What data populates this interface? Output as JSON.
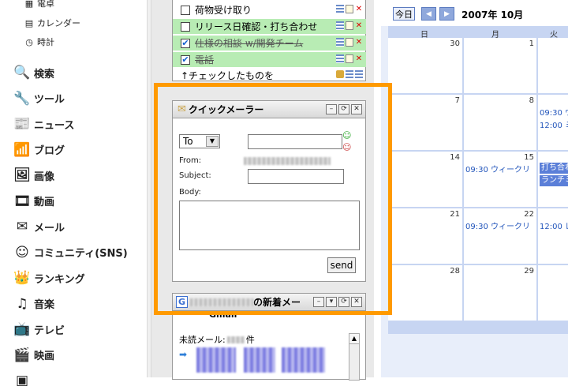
{
  "sidebar": {
    "sub_items": [
      {
        "label": "電卓",
        "icon": "calculator-icon",
        "glyph": "▦"
      },
      {
        "label": "カレンダー",
        "icon": "calendar-icon",
        "glyph": "▤"
      },
      {
        "label": "時計",
        "icon": "clock-icon",
        "glyph": "◷"
      }
    ],
    "nav_items": [
      {
        "label": "検索",
        "icon": "search-icon",
        "glyph": "🔍"
      },
      {
        "label": "ツール",
        "icon": "wrench-icon",
        "glyph": "🔧"
      },
      {
        "label": "ニュース",
        "icon": "news-icon",
        "glyph": "📰"
      },
      {
        "label": "ブログ",
        "icon": "blog-icon",
        "glyph": "📶"
      },
      {
        "label": "画像",
        "icon": "image-icon",
        "glyph": "🖼"
      },
      {
        "label": "動画",
        "icon": "video-icon",
        "glyph": "🎞"
      },
      {
        "label": "メール",
        "icon": "mail-icon",
        "glyph": "✉"
      },
      {
        "label": "コミュニティ(SNS)",
        "icon": "smiley-icon",
        "glyph": "☺"
      },
      {
        "label": "ランキング",
        "icon": "crown-icon",
        "glyph": "👑"
      },
      {
        "label": "音楽",
        "icon": "music-icon",
        "glyph": "♫"
      },
      {
        "label": "テレビ",
        "icon": "tv-icon",
        "glyph": "📺"
      },
      {
        "label": "映画",
        "icon": "clapper-icon",
        "glyph": "🎬"
      },
      {
        "label": "",
        "icon": "more-icon",
        "glyph": "▣"
      }
    ]
  },
  "todo": {
    "items": [
      {
        "label": "荷物受け取り",
        "checked": false,
        "highlight": false,
        "done": false
      },
      {
        "label": "リリース日確認・打ち合わせ",
        "checked": false,
        "highlight": true,
        "done": false
      },
      {
        "label": "仕様の相談 w/開発チーム",
        "checked": true,
        "highlight": true,
        "done": true
      },
      {
        "label": "電話",
        "checked": true,
        "highlight": true,
        "done": true
      }
    ],
    "footer": "↑チェックしたものを"
  },
  "quick_mailer": {
    "title": "クイックメーラー",
    "to_select": "To",
    "from_label": "From:",
    "subject_label": "Subject:",
    "body_label": "Body:",
    "send_label": "send",
    "buttons": {
      "minimize": "–",
      "refresh": "⟳",
      "close": "✕"
    }
  },
  "gmail_gadget": {
    "title_suffix": "の新着メー",
    "subtitle": "Gmail",
    "unread_label": "未読メール:",
    "unread_suffix": "件",
    "buttons": {
      "minimize": "–",
      "menu": "▾",
      "refresh": "⟳",
      "close": "✕"
    }
  },
  "calendar": {
    "today_label": "今日",
    "prev": "◀",
    "next": "▶",
    "title": "2007年 10月",
    "weekdays": [
      "日",
      "月",
      "火"
    ],
    "weeks": [
      {
        "days": [
          "30",
          "1",
          ""
        ],
        "events": []
      },
      {
        "days": [
          "7",
          "8",
          ""
        ],
        "events": [
          {
            "col": 2,
            "text": "09:30 ウ",
            "bar": false
          },
          {
            "col": 2,
            "text": "12:00 ミ",
            "bar": false
          }
        ]
      },
      {
        "days": [
          "14",
          "15",
          ""
        ],
        "events": [
          {
            "col": 1,
            "text": "09:30 ウィークリ",
            "bar": false
          },
          {
            "col": 2,
            "text": "打ち合わ",
            "bar": true
          },
          {
            "col": 2,
            "text": "ランチミー",
            "bar": true
          }
        ]
      },
      {
        "days": [
          "21",
          "22",
          ""
        ],
        "events": [
          {
            "col": 1,
            "text": "09:30 ウィークリ",
            "bar": false
          },
          {
            "col": 2,
            "text": "12:00 レ",
            "bar": false
          }
        ]
      },
      {
        "days": [
          "28",
          "29",
          ""
        ],
        "events": []
      }
    ]
  },
  "colors": {
    "highlight_border": "#ff9a00",
    "todo_highlight": "#b8ecb4",
    "calendar_bar": "#5b7fd8"
  }
}
